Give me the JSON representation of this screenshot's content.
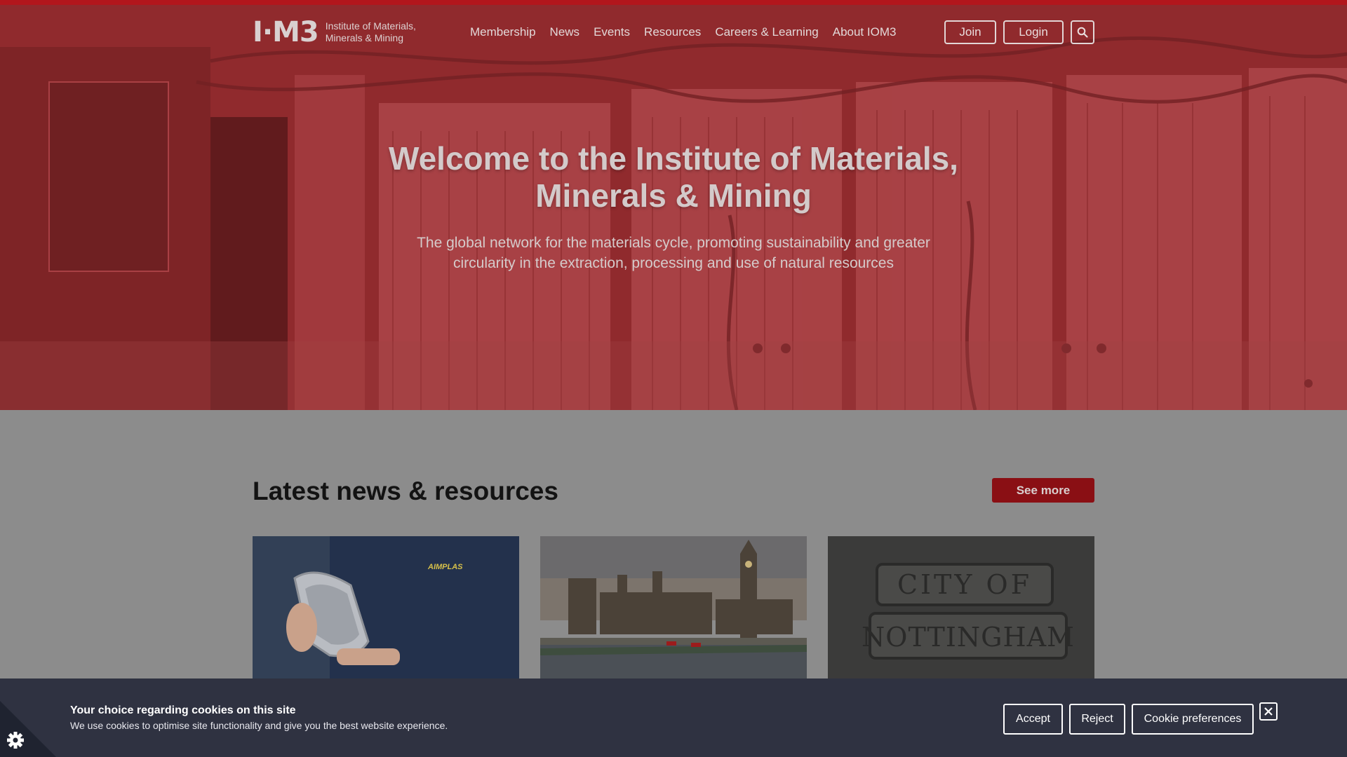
{
  "header": {
    "logo_mark": "I·M3",
    "logo_line1": "Institute of Materials,",
    "logo_line2": "Minerals & Mining",
    "nav": [
      "Membership",
      "News",
      "Events",
      "Resources",
      "Careers & Learning",
      "About IOM3"
    ],
    "join_label": "Join",
    "login_label": "Login",
    "search_icon": "search-icon"
  },
  "hero": {
    "title": "Welcome to the Institute of Materials, Minerals & Mining",
    "subtitle": "The global network for the materials cycle, promoting sustainability and greater circularity in the extraction, processing and use of natural resources"
  },
  "news": {
    "heading": "Latest news & resources",
    "see_more_label": "See more",
    "cards": [
      {
        "image": "person-holding-tray",
        "brand_text": "AIMPLAS"
      },
      {
        "image": "houses-of-parliament"
      },
      {
        "image": "city-of-nottingham-plaque",
        "plaque_line1": "CITY OF",
        "plaque_line2": "NOTTINGHAM"
      }
    ]
  },
  "cookie": {
    "title": "Your choice regarding cookies on this site",
    "text": "We use cookies to optimise site functionality and give you the best website experience.",
    "accept_label": "Accept",
    "reject_label": "Reject",
    "prefs_label": "Cookie preferences",
    "close_icon": "close-icon",
    "settings_icon": "gear-icon"
  },
  "colors": {
    "brand_red": "#b2161c",
    "banner_bg": "#2f3241"
  }
}
